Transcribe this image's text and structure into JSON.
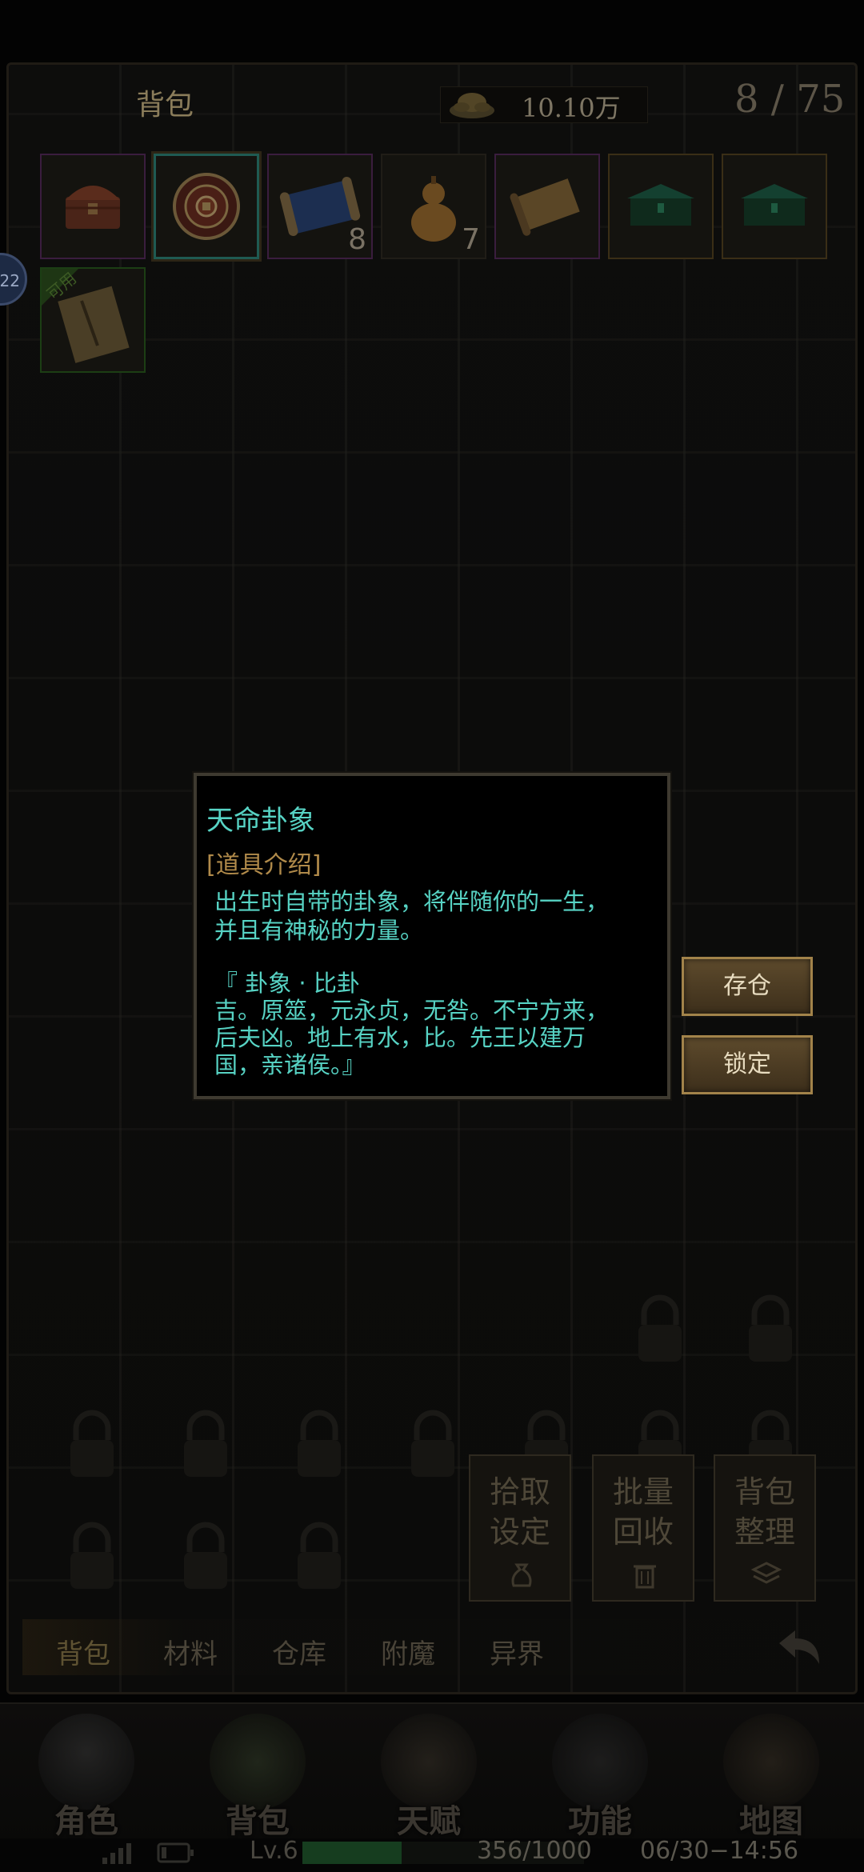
{
  "header": {
    "tab_title": "背包",
    "gold_amount": "10.10万",
    "capacity": "8 / 75"
  },
  "side_badge": "22",
  "inventory": {
    "slots": [
      {
        "name": "treasure-chest",
        "qty": ""
      },
      {
        "name": "fate-hexagram",
        "qty": ""
      },
      {
        "name": "blue-scroll",
        "qty": "8"
      },
      {
        "name": "gourd",
        "qty": "7"
      },
      {
        "name": "paper-scroll",
        "qty": ""
      },
      {
        "name": "green-chest",
        "qty": ""
      },
      {
        "name": "green-chest-2",
        "qty": ""
      },
      {
        "name": "book",
        "qty": "",
        "tag": "可用"
      }
    ]
  },
  "tooltip": {
    "title": "天命卦象",
    "section": "[道具介绍]",
    "lines": [
      "出生时自带的卦象，将伴随你的一生，",
      "并且有神秘的力量。",
      "『 卦象 · 比卦",
      "吉。原筮，元永贞，无咎。不宁方来，",
      "后夫凶。地上有水，比。先王以建万",
      "国，亲诸侯。』"
    ]
  },
  "item_buttons": {
    "store": "存仓",
    "lock": "锁定"
  },
  "actions": {
    "pickup_line1": "拾取",
    "pickup_line2": "设定",
    "recycle_line1": "批量",
    "recycle_line2": "回收",
    "sort_line1": "背包",
    "sort_line2": "整理"
  },
  "subtabs": [
    "背包",
    "材料",
    "仓库",
    "附魔",
    "异界"
  ],
  "bottom_nav": [
    "角色",
    "背包",
    "天赋",
    "功能",
    "地图"
  ],
  "status": {
    "level": "Lv.6",
    "exp": "356/1000",
    "exp_fraction": 0.356,
    "datetime": "06/30−14:56"
  },
  "colors": {
    "tooltip_text": "#57d3c4",
    "tooltip_section": "#b08a4a",
    "button_gold": "#a2834a"
  }
}
